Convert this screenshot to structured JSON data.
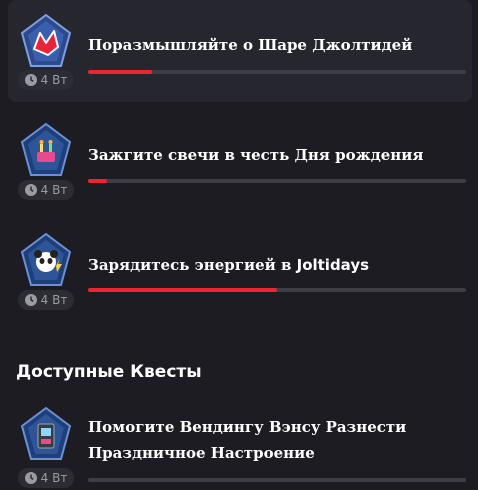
{
  "quests": [
    {
      "title": "Поразмышляйте о Шаре Джолтидей",
      "duration": "4 Вт",
      "progress": 0.17,
      "icon": "joltidays-red-shard-badge-icon"
    },
    {
      "title": "Зажгите свечи в честь Дня рождения",
      "duration": "4 Вт",
      "progress": 0.05,
      "icon": "birthday-candles-badge-icon"
    },
    {
      "title_serif": "Зарядитесь энергией в ",
      "title_sans": "Joltidays",
      "duration": "4 Вт",
      "progress": 0.5,
      "icon": "panda-energy-badge-icon"
    }
  ],
  "available": {
    "heading": "Доступные Квесты",
    "quest": {
      "title_line1": "Помогите Вендингу Вэнсу Разнести",
      "title_line2": "Праздничное Настроение",
      "duration": "4 Вт",
      "progress": 0,
      "icon": "vending-vance-badge-icon"
    }
  },
  "colors": {
    "accent": "#f0242e",
    "background": "#1c1c22",
    "track": "#3e3e46"
  }
}
